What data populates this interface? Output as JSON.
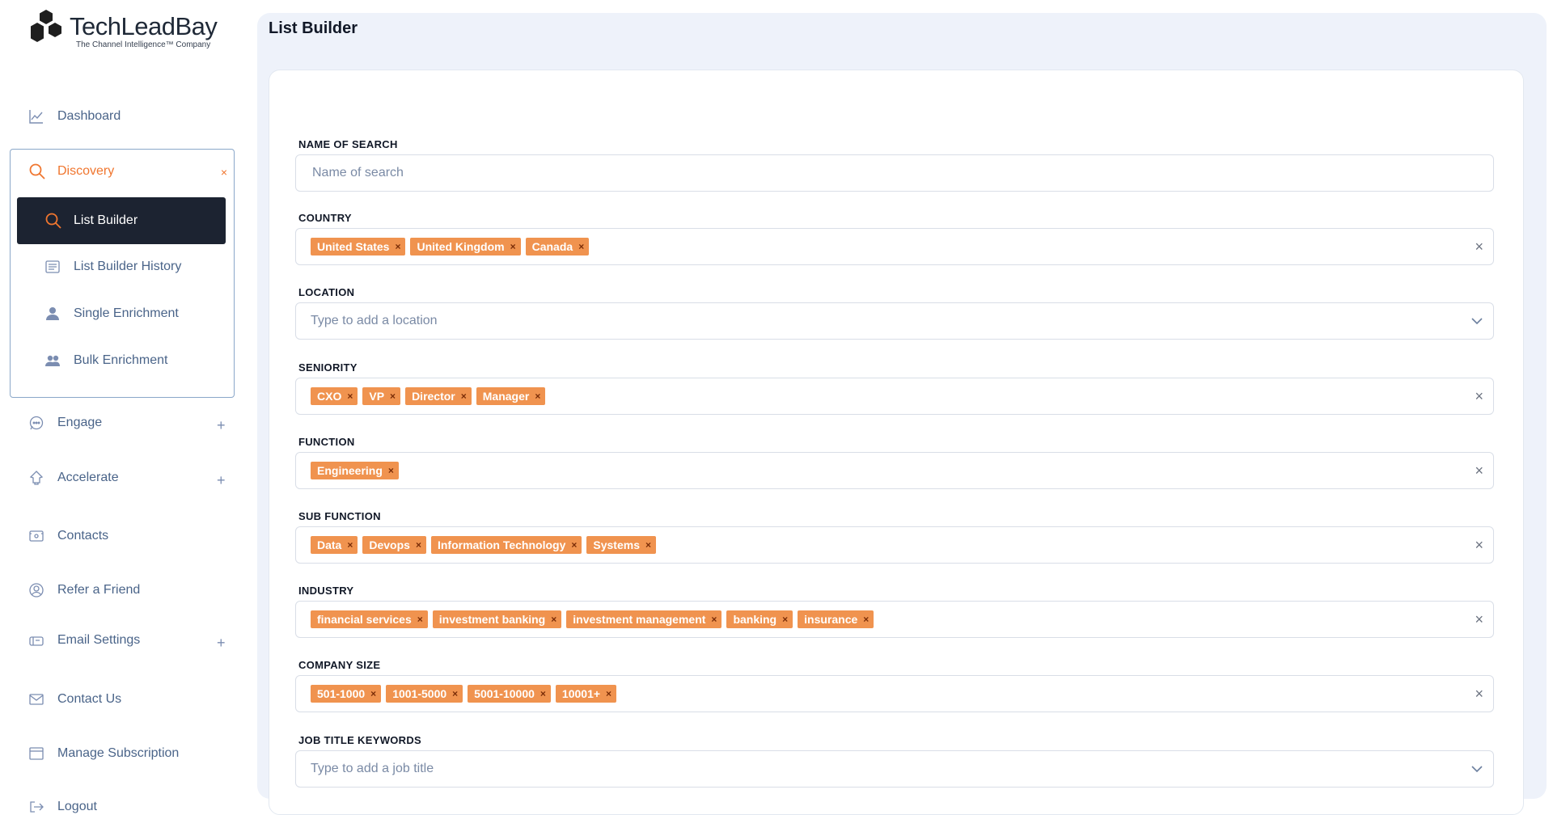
{
  "brand": {
    "name": "TechLeadBay",
    "tagline": "The Channel Intelligence™ Company"
  },
  "sidebar": {
    "dashboard": "Dashboard",
    "discovery": {
      "label": "Discovery",
      "close": "×",
      "items": [
        {
          "label": "List Builder",
          "active": true
        },
        {
          "label": "List Builder History"
        },
        {
          "label": "Single Enrichment"
        },
        {
          "label": "Bulk Enrichment"
        }
      ]
    },
    "engage": "Engage",
    "accelerate": "Accelerate",
    "contacts": "Contacts",
    "refer": "Refer a Friend",
    "email_settings": "Email Settings",
    "contact_us": "Contact Us",
    "manage_subscription": "Manage Subscription",
    "logout": "Logout",
    "expand_symbol": "+"
  },
  "main": {
    "title": "List Builder",
    "fields": {
      "name_of_search": {
        "label": "NAME OF SEARCH",
        "placeholder": "Name of search",
        "value": ""
      },
      "country": {
        "label": "COUNTRY",
        "chips": [
          "United States",
          "United Kingdom",
          "Canada"
        ]
      },
      "location": {
        "label": "LOCATION",
        "placeholder": "Type to add a location"
      },
      "seniority": {
        "label": "SENIORITY",
        "chips": [
          "CXO",
          "VP",
          "Director",
          "Manager"
        ]
      },
      "function": {
        "label": "FUNCTION",
        "chips": [
          "Engineering"
        ]
      },
      "sub_function": {
        "label": "SUB FUNCTION",
        "chips": [
          "Data",
          "Devops",
          "Information Technology",
          "Systems"
        ]
      },
      "industry": {
        "label": "INDUSTRY",
        "chips": [
          "financial services",
          "investment banking",
          "investment management",
          "banking",
          "insurance"
        ]
      },
      "company_size": {
        "label": "COMPANY SIZE",
        "chips": [
          "501-1000",
          "1001-5000",
          "5001-10000",
          "10001+"
        ]
      },
      "job_title_keywords": {
        "label": "JOB TITLE KEYWORDS",
        "placeholder": "Type to add a job title"
      }
    },
    "chip_remove": "×",
    "clear_symbol": "×"
  },
  "colors": {
    "accent": "#f0762f",
    "chip": "#f0934f",
    "nav_text": "#4a6489",
    "active_bg": "#1c2331",
    "panel_bg": "#eef2fa"
  }
}
